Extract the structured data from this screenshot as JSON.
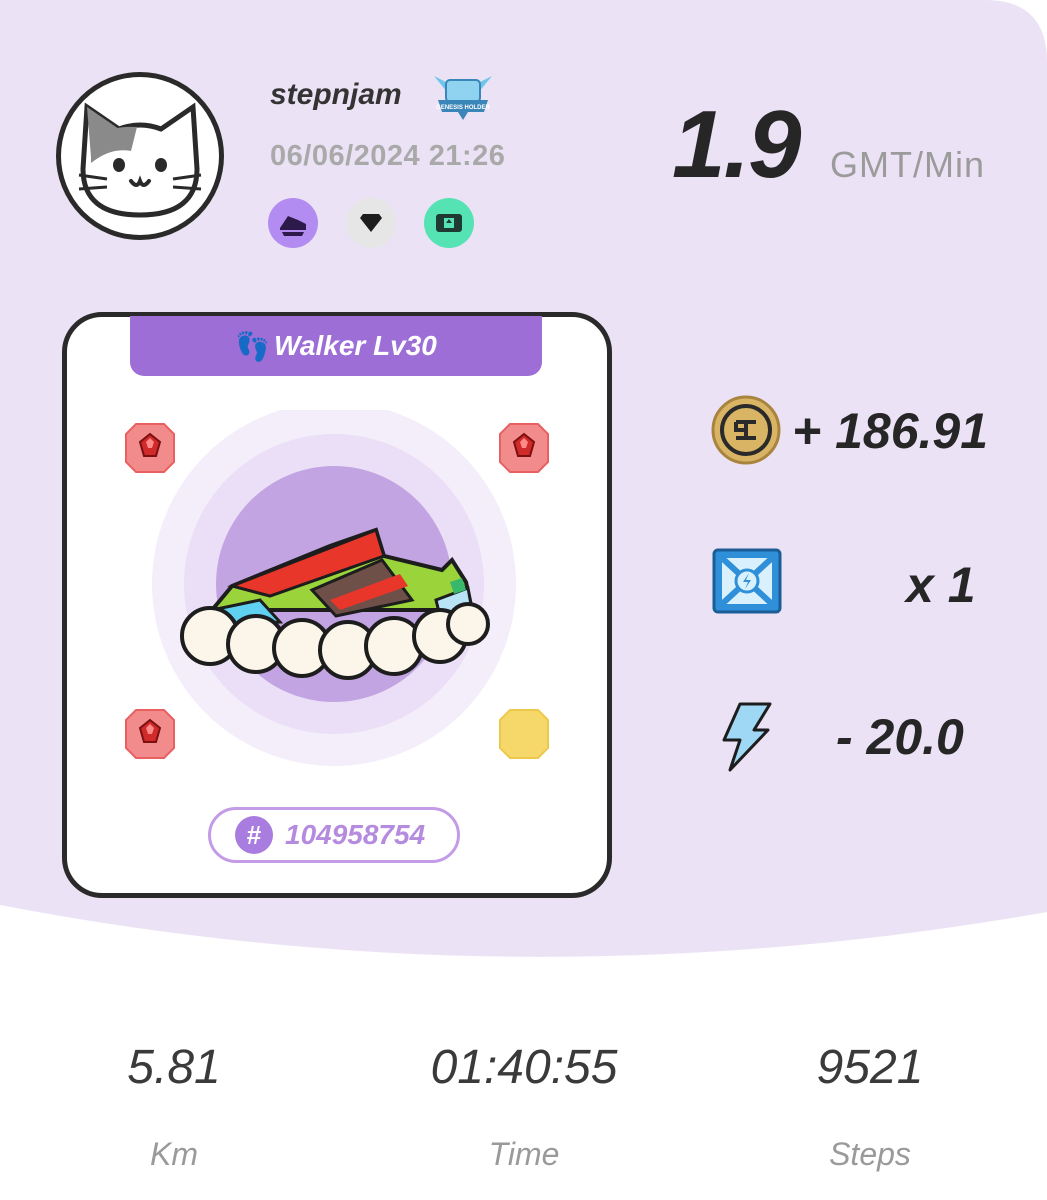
{
  "profile": {
    "username": "stepnjam",
    "badge_text": "GENESIS HOLDER",
    "datetime": "06/06/2024 21:26",
    "avatar_icon": "cat-avatar-icon",
    "badges": [
      {
        "icon": "sneaker-badge-icon",
        "color": "#b28cf0"
      },
      {
        "icon": "gem-badge-icon",
        "color": "#e6e6e6"
      },
      {
        "icon": "ticket-badge-icon",
        "color": "#55e3b4"
      }
    ]
  },
  "rate": {
    "value": "1.9",
    "unit": "GMT/Min"
  },
  "sneaker": {
    "type_label": "Walker Lv30",
    "id_hash": "#",
    "id": "104958754",
    "sockets": [
      "red-gem",
      "red-gem",
      "red-gem",
      "yellow-empty"
    ]
  },
  "rewards": [
    {
      "icon": "gst-coin-icon",
      "text": "+ 186.91"
    },
    {
      "icon": "mystery-box-icon",
      "text": "x 1"
    },
    {
      "icon": "energy-bolt-icon",
      "text": "- 20.0"
    }
  ],
  "stats": [
    {
      "value": "5.81",
      "label": "Km"
    },
    {
      "value": "01:40:55",
      "label": "Time"
    },
    {
      "value": "9521",
      "label": "Steps"
    }
  ],
  "colors": {
    "background_top": "#ece2f5",
    "accent_purple": "#9d6ed6",
    "mint": "#55e3b4"
  }
}
